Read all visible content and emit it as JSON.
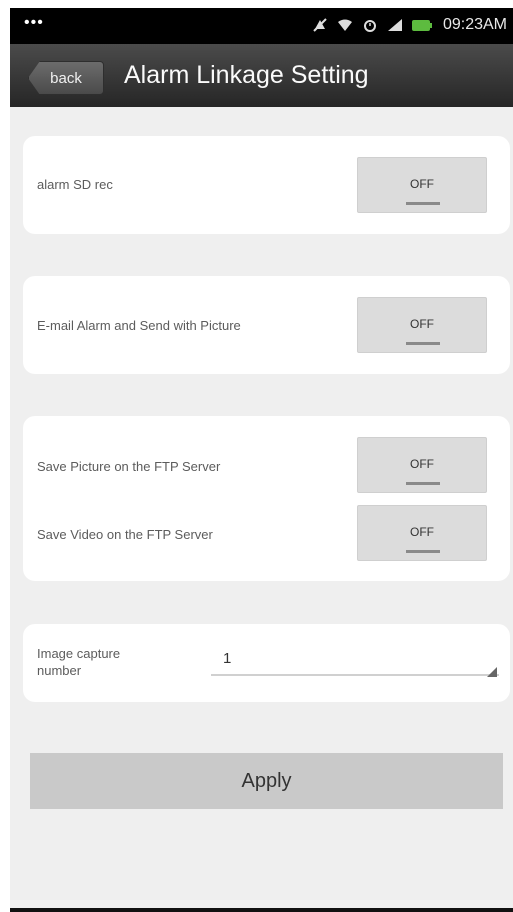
{
  "status_bar": {
    "dots": "•••",
    "time": "09:23AM",
    "icons": [
      "notification-off-icon",
      "wifi-icon",
      "alarm-icon",
      "signal-icon",
      "battery-icon"
    ]
  },
  "action_bar": {
    "back_label": "back",
    "title": "Alarm Linkage Setting"
  },
  "sections": {
    "sd_rec": {
      "label": "alarm SD rec",
      "value": "OFF"
    },
    "email": {
      "label": "E-mail Alarm and Send with Picture",
      "value": "OFF"
    },
    "ftp_picture": {
      "label": "Save Picture on the FTP Server",
      "value": "OFF"
    },
    "ftp_video": {
      "label": "Save Video on the FTP Server",
      "value": "OFF"
    },
    "capture": {
      "label_line1": "Image capture",
      "label_line2": "number",
      "value": "1"
    }
  },
  "apply_label": "Apply",
  "colors": {
    "battery": "#5dbb3f",
    "background": "#efefef",
    "toggle": "#dcdcdc",
    "apply": "#c9c9c9"
  }
}
